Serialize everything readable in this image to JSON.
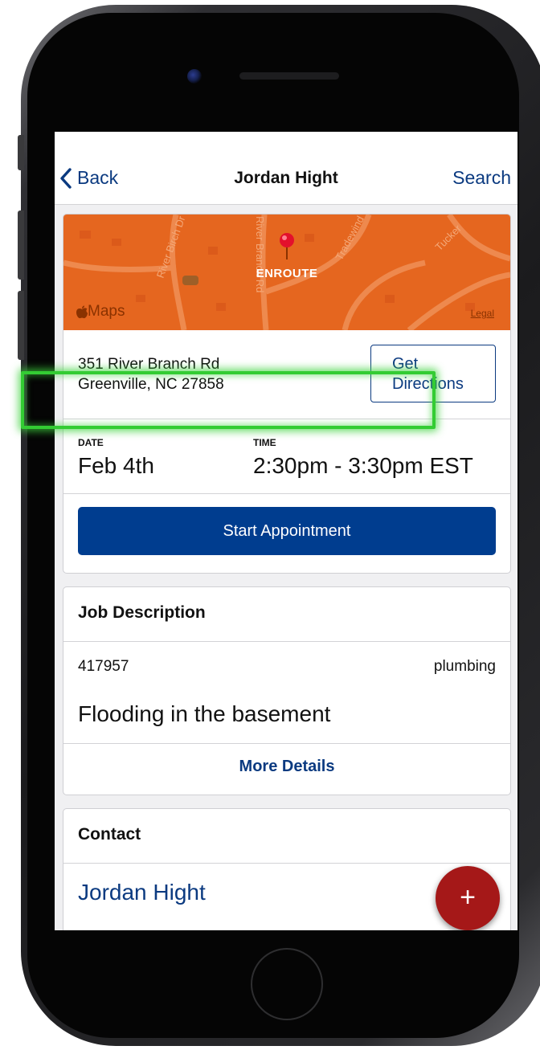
{
  "nav": {
    "back_label": "Back",
    "title": "Jordan Hight",
    "search_label": "Search"
  },
  "map": {
    "status": "ENROUTE",
    "logo_text": "Maps",
    "legal_label": "Legal",
    "tint_color": "#e5661f"
  },
  "address": {
    "line1": "351 River Branch Rd",
    "line2": "Greenville, NC 27858",
    "directions_line1": "Get",
    "directions_line2": "Directions"
  },
  "schedule": {
    "date_label": "DATE",
    "date_value": "Feb 4th",
    "time_label": "TIME",
    "time_value": "2:30pm - 3:30pm EST"
  },
  "actions": {
    "start_label": "Start Appointment",
    "start_color": "#003d8f",
    "highlight_color": "#33cc33"
  },
  "job": {
    "header": "Job Description",
    "id": "417957",
    "type": "plumbing",
    "summary": "Flooding in the basement",
    "more_label": "More Details"
  },
  "contact": {
    "header": "Contact",
    "name": "Jordan Hight"
  },
  "fab": {
    "label": "+",
    "color": "#a51818"
  }
}
